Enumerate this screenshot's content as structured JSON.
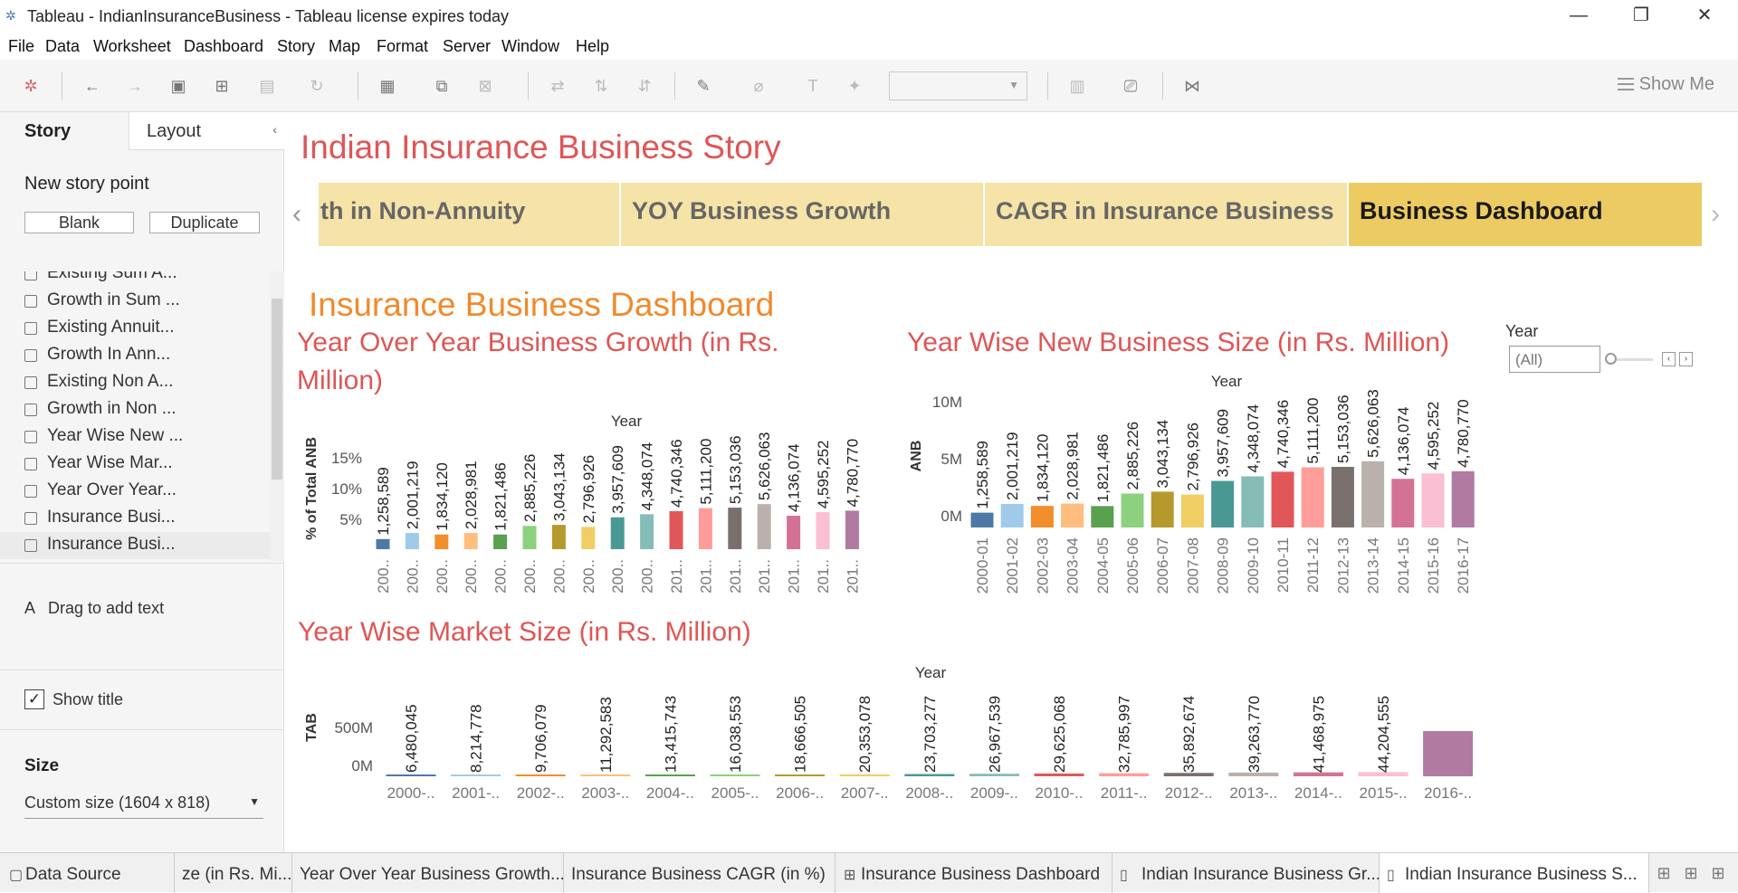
{
  "window": {
    "title": "Tableau - IndianInsuranceBusiness - Tableau license expires today"
  },
  "menu": [
    "File",
    "Data",
    "Worksheet",
    "Dashboard",
    "Story",
    "Map",
    "Format",
    "Server",
    "Window",
    "Help"
  ],
  "toolbar": {
    "show_me": "Show Me"
  },
  "left_panel": {
    "tabs": [
      "Story",
      "Layout"
    ],
    "new_story_point": "New story point",
    "blank": "Blank",
    "duplicate": "Duplicate",
    "sheets": [
      "Existing Sum A...",
      "Growth in Sum ...",
      "Existing Annuit...",
      "Growth In Ann...",
      "Existing Non A...",
      "Growth in Non ...",
      "Year Wise New ...",
      "Year Wise Mar...",
      "Year Over Year...",
      "Insurance Busi...",
      "Insurance Busi..."
    ],
    "drag_text": "Drag to add text",
    "drag_icon": "A",
    "show_title": "Show title",
    "size_heading": "Size",
    "size_value": "Custom size (1604 x 818)"
  },
  "story": {
    "title": "Indian Insurance Business Story",
    "points": [
      "th in Non-Annuity",
      "YOY Business Growth",
      "CAGR in Insurance Business",
      "Business Dashboard"
    ],
    "active_point": 3
  },
  "dashboard": {
    "title": "Insurance Business Dashboard",
    "year_filter": {
      "label": "Year",
      "value": "(All)"
    }
  },
  "chart_data": [
    {
      "type": "bar",
      "title": "Year Over Year Business Growth (in Rs. Million)",
      "xlabel": "Year",
      "ylabel": "% of Total ANB",
      "categories": [
        "200..",
        "200..",
        "200..",
        "200..",
        "200..",
        "200..",
        "200..",
        "200..",
        "200..",
        "200..",
        "201..",
        "201..",
        "201..",
        "201..",
        "201..",
        "201..",
        "201.."
      ],
      "values": [
        2.0,
        3.2,
        2.9,
        3.2,
        2.9,
        4.6,
        4.8,
        4.4,
        6.3,
        6.9,
        7.5,
        8.1,
        8.2,
        8.9,
        6.6,
        7.3,
        7.6
      ],
      "data_labels": [
        "1,258,589",
        "2,001,219",
        "1,834,120",
        "2,028,981",
        "1,821,486",
        "2,885,226",
        "3,043,134",
        "2,796,926",
        "3,957,609",
        "4,348,074",
        "4,740,346",
        "5,111,200",
        "5,153,036",
        "5,626,063",
        "4,136,074",
        "4,595,252",
        "4,780,770"
      ],
      "yticks": [
        "5%",
        "10%",
        "15%"
      ],
      "colors": [
        "#4e79a7",
        "#a0cbe8",
        "#f28e2b",
        "#ffbe7d",
        "#59a14f",
        "#8cd17d",
        "#b6992d",
        "#f1ce63",
        "#499894",
        "#86bcb6",
        "#e15759",
        "#ff9d9a",
        "#79706e",
        "#bab0ac",
        "#d37295",
        "#fabfd2",
        "#b07aa1"
      ]
    },
    {
      "type": "bar",
      "title": "Year Wise New Business Size (in Rs. Million)",
      "xlabel": "Year",
      "ylabel": "ANB",
      "categories": [
        "2000-01",
        "2001-02",
        "2002-03",
        "2003-04",
        "2004-05",
        "2005-06",
        "2006-07",
        "2007-08",
        "2008-09",
        "2009-10",
        "2010-11",
        "2011-12",
        "2012-13",
        "2013-14",
        "2014-15",
        "2015-16",
        "2016-17"
      ],
      "values": [
        1258589,
        2001219,
        1834120,
        2028981,
        1821486,
        2885226,
        3043134,
        2796926,
        3957609,
        4348074,
        4740346,
        5111200,
        5153036,
        5626063,
        4136074,
        4595252,
        4780770
      ],
      "data_labels": [
        "1,258,589",
        "2,001,219",
        "1,834,120",
        "2,028,981",
        "1,821,486",
        "2,885,226",
        "3,043,134",
        "2,796,926",
        "3,957,609",
        "4,348,074",
        "4,740,346",
        "5,111,200",
        "5,153,036",
        "5,626,063",
        "4,136,074",
        "4,595,252",
        "4,780,770"
      ],
      "yticks": [
        "0M",
        "5M",
        "10M"
      ],
      "ylim": [
        0,
        10000000
      ]
    },
    {
      "type": "bar",
      "title": "Year Wise Market Size (in Rs. Million)",
      "xlabel": "Year",
      "ylabel": "TAB",
      "categories": [
        "2000-..",
        "2001-..",
        "2002-..",
        "2003-..",
        "2004-..",
        "2005-..",
        "2006-..",
        "2007-..",
        "2008-..",
        "2009-..",
        "2010-..",
        "2011-..",
        "2012-..",
        "2013-..",
        "2014-..",
        "2015-..",
        "2016-.."
      ],
      "values": [
        6480045,
        8214778,
        9706079,
        11292583,
        13415743,
        16038553,
        18666505,
        20353078,
        23703277,
        26967539,
        29625068,
        32785997,
        35892674,
        39263770,
        41468975,
        44204555,
        480000000
      ],
      "data_labels": [
        "6,480,045",
        "8,214,778",
        "9,706,079",
        "11,292,583",
        "13,415,743",
        "16,038,553",
        "18,666,505",
        "20,353,078",
        "23,703,277",
        "26,967,539",
        "29,625,068",
        "32,785,997",
        "35,892,674",
        "39,263,770",
        "41,468,975",
        "44,204,555",
        ""
      ],
      "yticks": [
        "0M",
        "500M"
      ],
      "ylim": [
        0,
        500000000
      ]
    }
  ],
  "bottom_tabs": [
    "Data Source",
    "ze (in Rs. Mi...",
    "Year Over Year Business Growth...",
    "Insurance Business CAGR (in %)",
    "Insurance Business Dashboard",
    "Indian Insurance Business Gr...",
    "Indian Insurance Business S..."
  ]
}
